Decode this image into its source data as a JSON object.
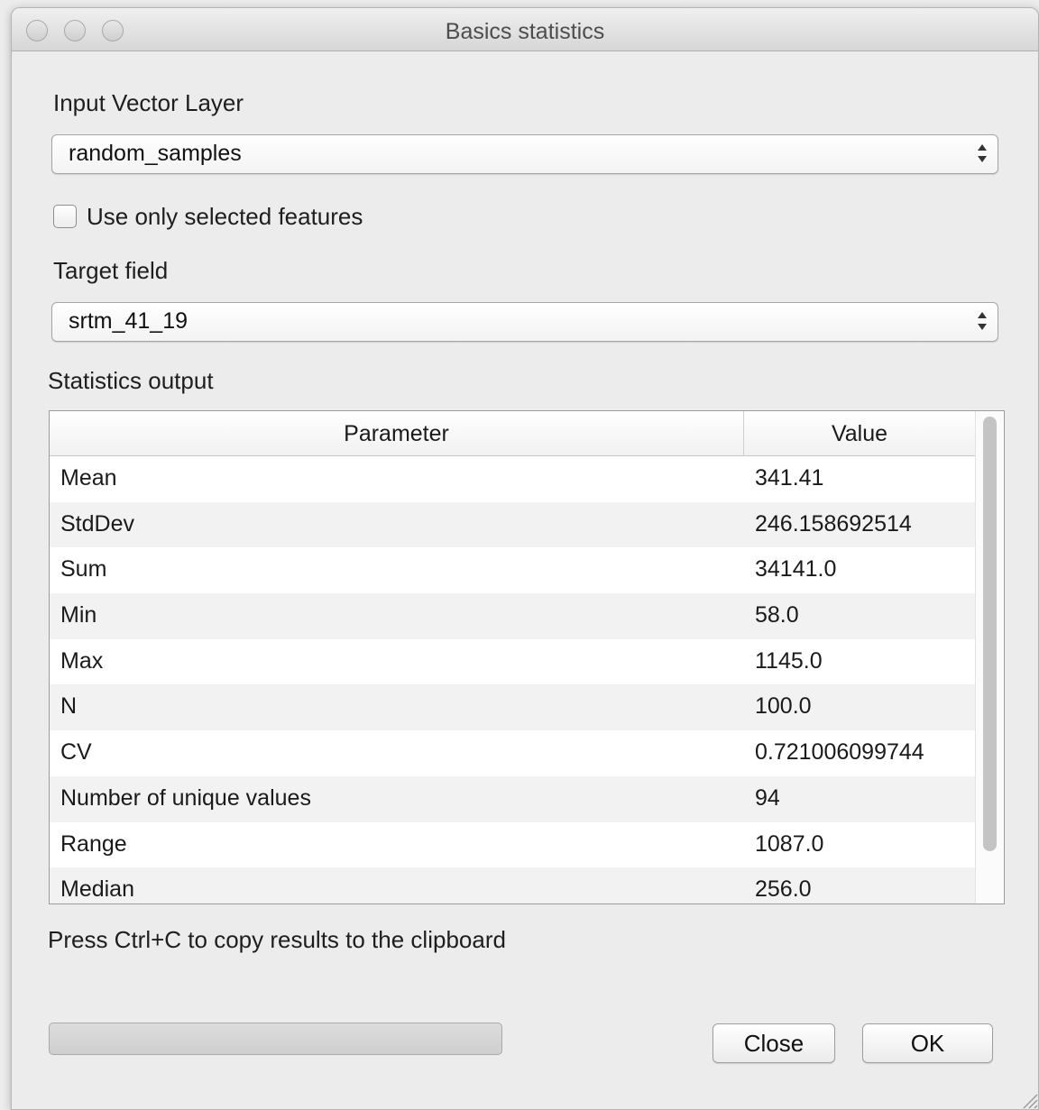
{
  "window": {
    "title": "Basics statistics"
  },
  "input_layer": {
    "label": "Input Vector Layer",
    "value": "random_samples"
  },
  "selected_only": {
    "label": "Use only selected features",
    "checked": false
  },
  "target_field": {
    "label": "Target field",
    "value": "srtm_41_19"
  },
  "statistics": {
    "label": "Statistics output",
    "columns": [
      "Parameter",
      "Value"
    ],
    "rows": [
      {
        "parameter": "Mean",
        "value": "341.41"
      },
      {
        "parameter": "StdDev",
        "value": "246.158692514"
      },
      {
        "parameter": "Sum",
        "value": "34141.0"
      },
      {
        "parameter": "Min",
        "value": "58.0"
      },
      {
        "parameter": "Max",
        "value": "1145.0"
      },
      {
        "parameter": "N",
        "value": "100.0"
      },
      {
        "parameter": "CV",
        "value": "0.721006099744"
      },
      {
        "parameter": "Number of unique values",
        "value": "94"
      },
      {
        "parameter": "Range",
        "value": "1087.0"
      },
      {
        "parameter": "Median",
        "value": "256.0"
      }
    ]
  },
  "hint": "Press Ctrl+C to copy results to the clipboard",
  "progress": {
    "value": 0
  },
  "buttons": {
    "close": "Close",
    "ok": "OK"
  }
}
